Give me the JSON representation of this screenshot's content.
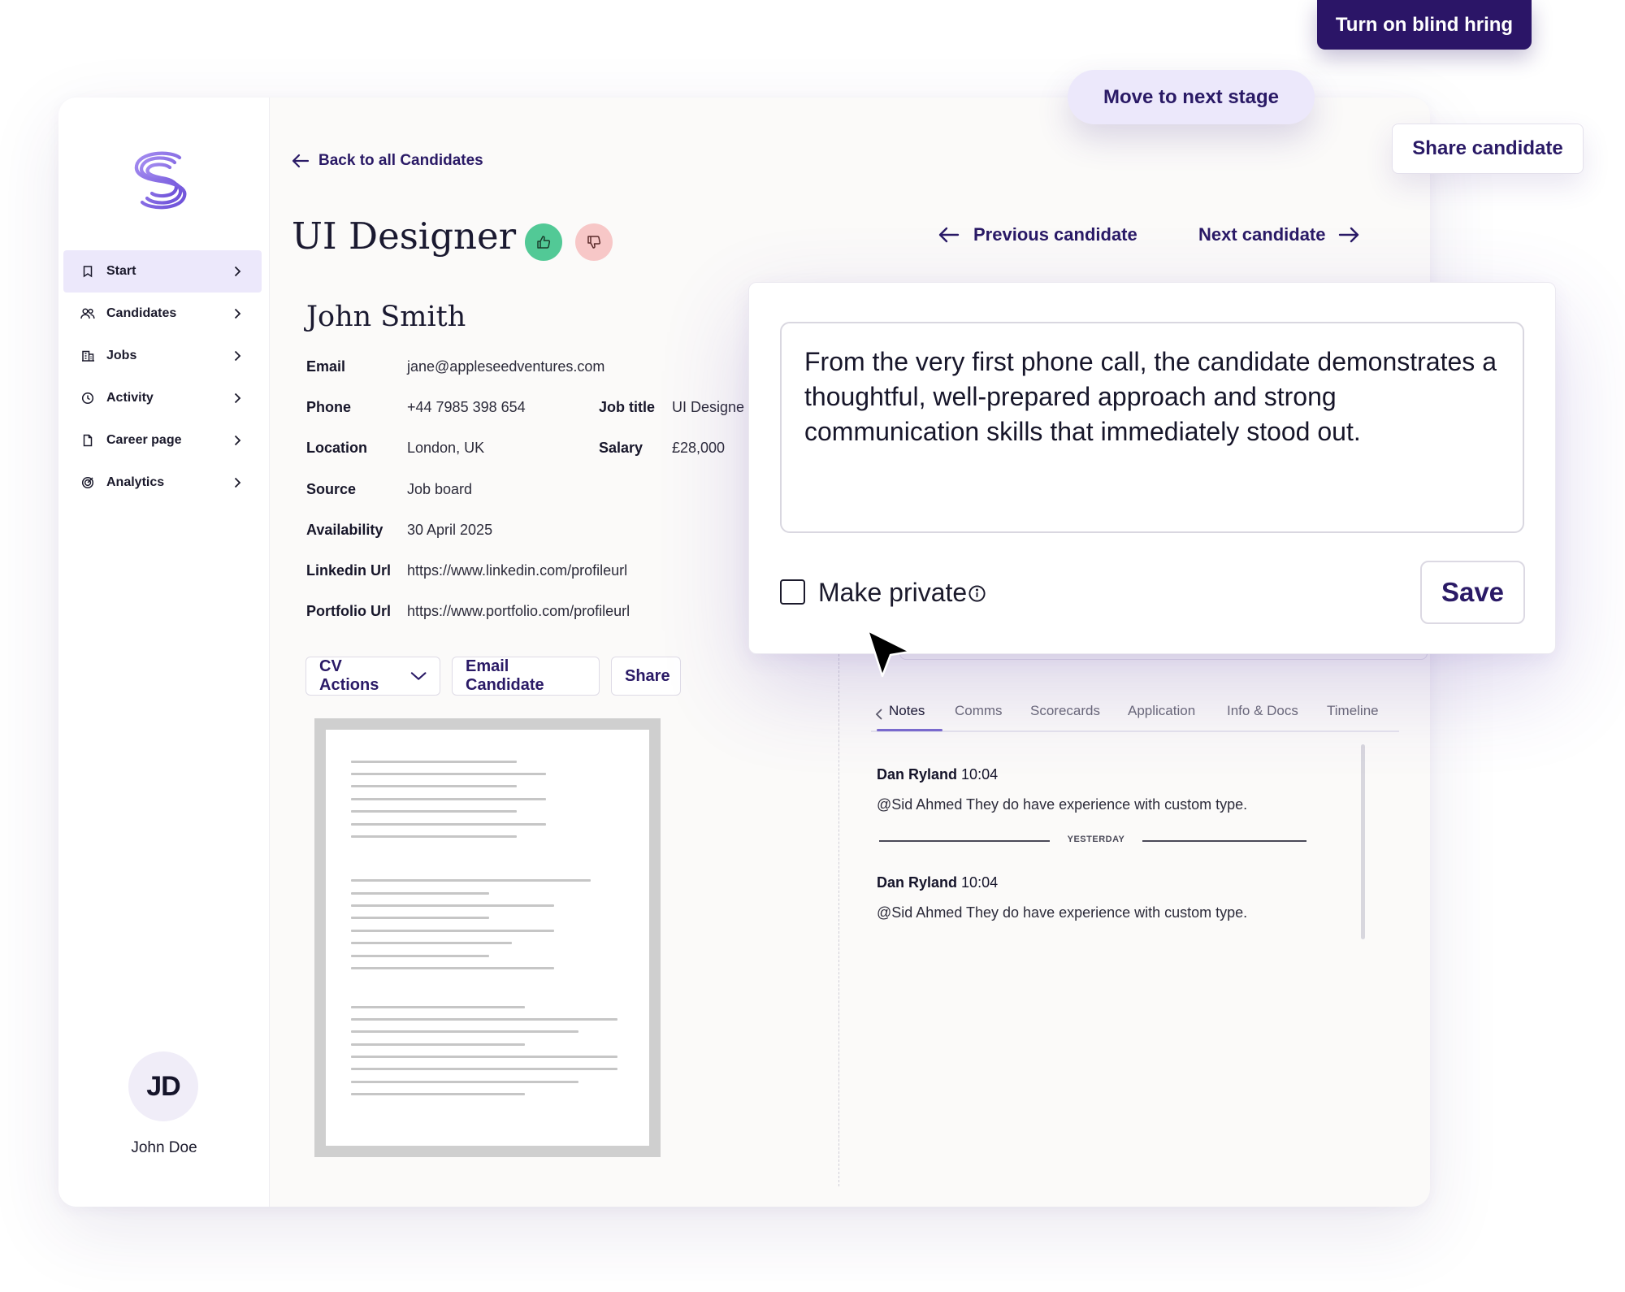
{
  "floating": {
    "blind_hiring_label": "Turn on blind hring",
    "next_stage_label": "Move to next stage",
    "share_candidate_label": "Share candidate"
  },
  "sidebar": {
    "items": [
      {
        "label": "Start",
        "icon": "bookmark-icon"
      },
      {
        "label": "Candidates",
        "icon": "people-icon"
      },
      {
        "label": "Jobs",
        "icon": "building-icon"
      },
      {
        "label": "Activity",
        "icon": "clock-icon"
      },
      {
        "label": "Career page",
        "icon": "document-icon"
      },
      {
        "label": "Analytics",
        "icon": "target-icon"
      }
    ],
    "user": {
      "initials": "JD",
      "name": "John Doe"
    }
  },
  "header": {
    "back_label": "Back to all Candidates",
    "title": "UI Designer",
    "prev_label": "Previous candidate",
    "next_label": "Next candidate"
  },
  "candidate": {
    "name": "John Smith",
    "fields": {
      "email": {
        "label": "Email",
        "value": "jane@appleseedventures.com"
      },
      "phone": {
        "label": "Phone",
        "value": "+44 7985 398 654"
      },
      "job_title": {
        "label": "Job title",
        "value": "UI Designe"
      },
      "location": {
        "label": "Location",
        "value": "London, UK"
      },
      "salary": {
        "label": "Salary",
        "value": "£28,000"
      },
      "source": {
        "label": "Source",
        "value": "Job board"
      },
      "availability": {
        "label": "Availability",
        "value": "30 April 2025"
      },
      "linkedin": {
        "label": "Linkedin Url",
        "value": "https://www.linkedin.com/profileurl"
      },
      "portfolio": {
        "label": "Portfolio Url",
        "value": "https://www.portfolio.com/profileurl"
      }
    }
  },
  "actions": {
    "cv_actions": "CV Actions",
    "email_candidate": "Email Candidate",
    "share": "Share"
  },
  "tabs": [
    "Notes",
    "Comms",
    "Scorecards",
    "Application",
    "Info & Docs",
    "Timeline"
  ],
  "notes": {
    "items": [
      {
        "author": "Dan Ryland",
        "time": "10:04",
        "text": "@Sid Ahmed They do have experience with custom type."
      },
      {
        "author": "Dan Ryland",
        "time": "10:04",
        "text": "@Sid Ahmed They do have experience with custom type."
      }
    ],
    "divider_label": "YESTERDAY"
  },
  "note_editor": {
    "text": "From the very first phone call, the candidate demonstrates a thoughtful, well-prepared approach and strong communication skills that immediately stood out.",
    "private_label": "Make private",
    "save_label": "Save"
  },
  "colors": {
    "brand": "#2b1567",
    "accent": "#7b6ccf",
    "thumbs_up": "#52c996",
    "thumbs_down": "#f7c7c7"
  }
}
